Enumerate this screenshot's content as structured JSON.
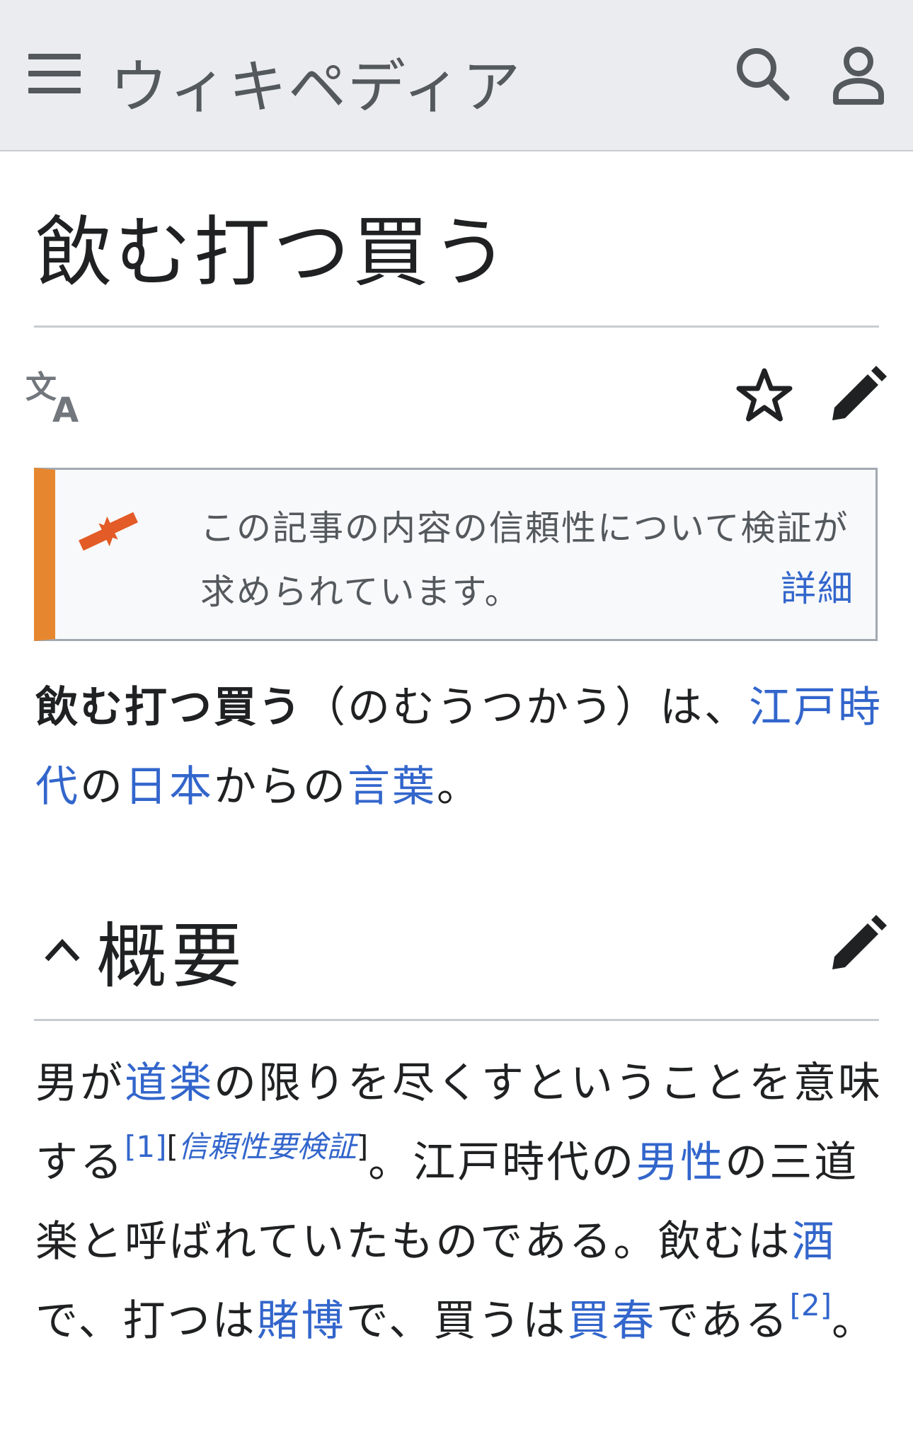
{
  "header": {
    "wordmark": "ウィキペディア",
    "menu_icon": "hamburger-menu-icon",
    "search_icon": "search-icon",
    "user_icon": "user-icon"
  },
  "page": {
    "title": "飲む打つ買う"
  },
  "actions": {
    "language_icon": "language-icon",
    "watch_icon": "star-icon",
    "edit_icon": "pencil-edit-icon"
  },
  "ambox": {
    "icon": "merge-arrows-icon",
    "text": "この記事の内容の信頼性について検証が求められています。",
    "link": "詳細",
    "accent_color": "#e6872f"
  },
  "lead": {
    "bold_term": "飲む打つ買う",
    "t1": "（のむうつかう）は、",
    "link1": "江戸時代",
    "t2": "の",
    "link2": "日本",
    "t3": "からの",
    "link3": "言葉",
    "t4": "。"
  },
  "section": {
    "toggle_icon": "chevron-up-icon",
    "title": "概要",
    "edit_icon": "pencil-edit-icon"
  },
  "body": {
    "t1": "男が",
    "link1": "道楽",
    "t2": "の限りを尽くすということを意味する",
    "ref1": "[1]",
    "cn_open": "[",
    "cn_text": "信頼性要検証",
    "cn_close": "]",
    "t3": "。江戸時代の",
    "link2": "男性",
    "t4": "の三道楽と呼ばれていたものである。飲むは",
    "link3": "酒",
    "t5": "で、打つは",
    "link4": "賭博",
    "t6": "で、買うは",
    "link5": "買春",
    "t7": "である",
    "ref2": "[2]",
    "t8": "。"
  },
  "colors": {
    "link": "#3366cc",
    "header_bg": "#eaecf0",
    "icon": "#54595d"
  }
}
